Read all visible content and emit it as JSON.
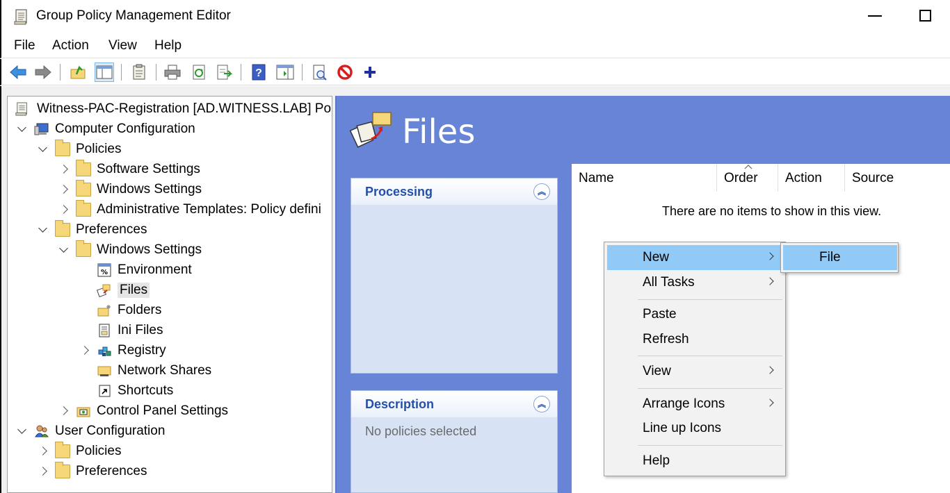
{
  "window": {
    "title": "Group Policy Management Editor"
  },
  "menu": [
    "File",
    "Action",
    "View",
    "Help"
  ],
  "toolbar": {
    "buttons": [
      "back-icon",
      "forward-icon",
      "up-folder-icon",
      "show-hide-tree-icon",
      "properties-icon",
      "print-icon",
      "refresh-icon",
      "export-list-icon",
      "help-icon",
      "show-action-pane-icon",
      "details-icon",
      "disable-icon",
      "add-icon"
    ]
  },
  "tree": {
    "root": "Witness-PAC-Registration [AD.WITNESS.LAB] Poli",
    "items": [
      {
        "label": "Computer Configuration"
      },
      {
        "label": "Policies"
      },
      {
        "label": "Software Settings"
      },
      {
        "label": "Windows Settings"
      },
      {
        "label": "Administrative Templates: Policy defini"
      },
      {
        "label": "Preferences"
      },
      {
        "label": "Windows Settings"
      },
      {
        "label": "Environment"
      },
      {
        "label": "Files"
      },
      {
        "label": "Folders"
      },
      {
        "label": "Ini Files"
      },
      {
        "label": "Registry"
      },
      {
        "label": "Network Shares"
      },
      {
        "label": "Shortcuts"
      },
      {
        "label": "Control Panel Settings"
      },
      {
        "label": "User Configuration"
      },
      {
        "label": "Policies"
      },
      {
        "label": "Preferences"
      }
    ]
  },
  "details": {
    "title": "Files",
    "processing": {
      "title": "Processing"
    },
    "description": {
      "title": "Description",
      "text": "No policies selected"
    },
    "columns": [
      "Name",
      "Order",
      "Action",
      "Source"
    ],
    "empty_message": "There are no items to show in this view."
  },
  "context_menu": {
    "items": [
      "New",
      "All Tasks",
      "Paste",
      "Refresh",
      "View",
      "Arrange Icons",
      "Line up Icons",
      "Help"
    ],
    "submenu": [
      "File"
    ]
  },
  "colors": {
    "accent": "#6784d6",
    "highlight": "#91c9f7",
    "panel_title": "#2450a8"
  }
}
